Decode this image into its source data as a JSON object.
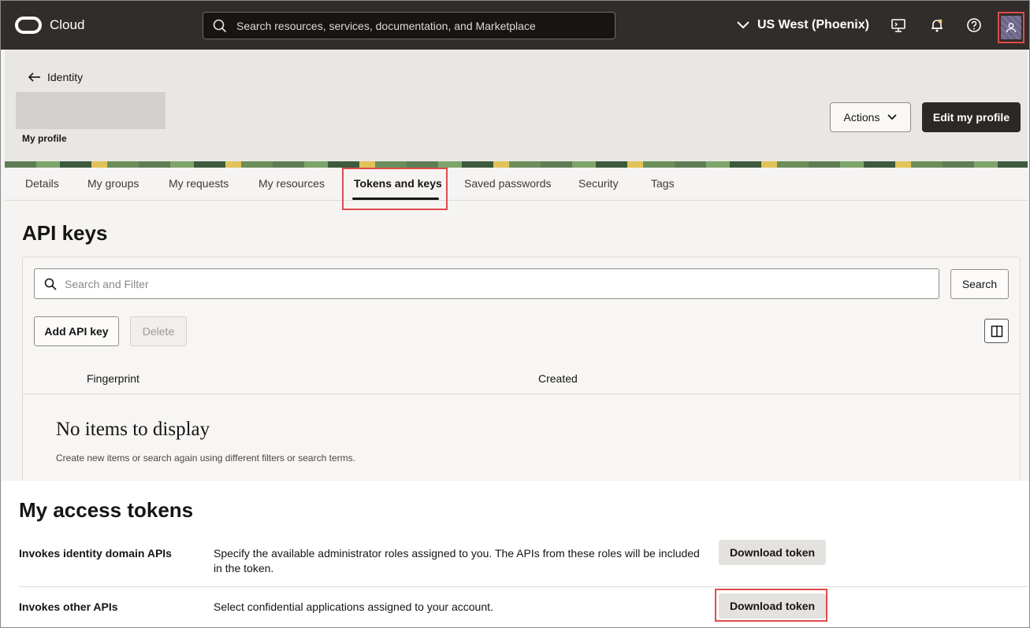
{
  "topbar": {
    "logo_text": "Cloud",
    "search_placeholder": "Search resources, services, documentation, and Marketplace",
    "region": "US West (Phoenix)",
    "icons": [
      "cloud-shell-icon",
      "bell-icon",
      "help-icon",
      "user-icon"
    ]
  },
  "header": {
    "back_label": "Identity",
    "subtitle": "My profile",
    "actions_label": "Actions",
    "edit_label": "Edit my profile"
  },
  "tabs": [
    "Details",
    "My groups",
    "My requests",
    "My resources",
    "Tokens and keys",
    "Saved passwords",
    "Security",
    "Tags"
  ],
  "active_tab": "Tokens and keys",
  "api_keys": {
    "title": "API keys",
    "filter_placeholder": "Search and Filter",
    "search_label": "Search",
    "add_label": "Add API key",
    "delete_label": "Delete",
    "columns": [
      "Fingerprint",
      "Created"
    ],
    "empty_title": "No items to display",
    "empty_subtitle": "Create new items or search again using different filters or search terms."
  },
  "access_tokens": {
    "title": "My access tokens",
    "rows": [
      {
        "label": "Invokes identity domain APIs",
        "description": "Specify the available administrator roles assigned to you. The APIs from these roles will be included in the token.",
        "button": "Download token"
      },
      {
        "label": "Invokes other APIs",
        "description": "Select confidential applications assigned to your account.",
        "button": "Download token"
      }
    ]
  },
  "colors": {
    "topbar": "#312d2a",
    "highlight": "#e04b4b",
    "primary_button": "#2b2825"
  }
}
